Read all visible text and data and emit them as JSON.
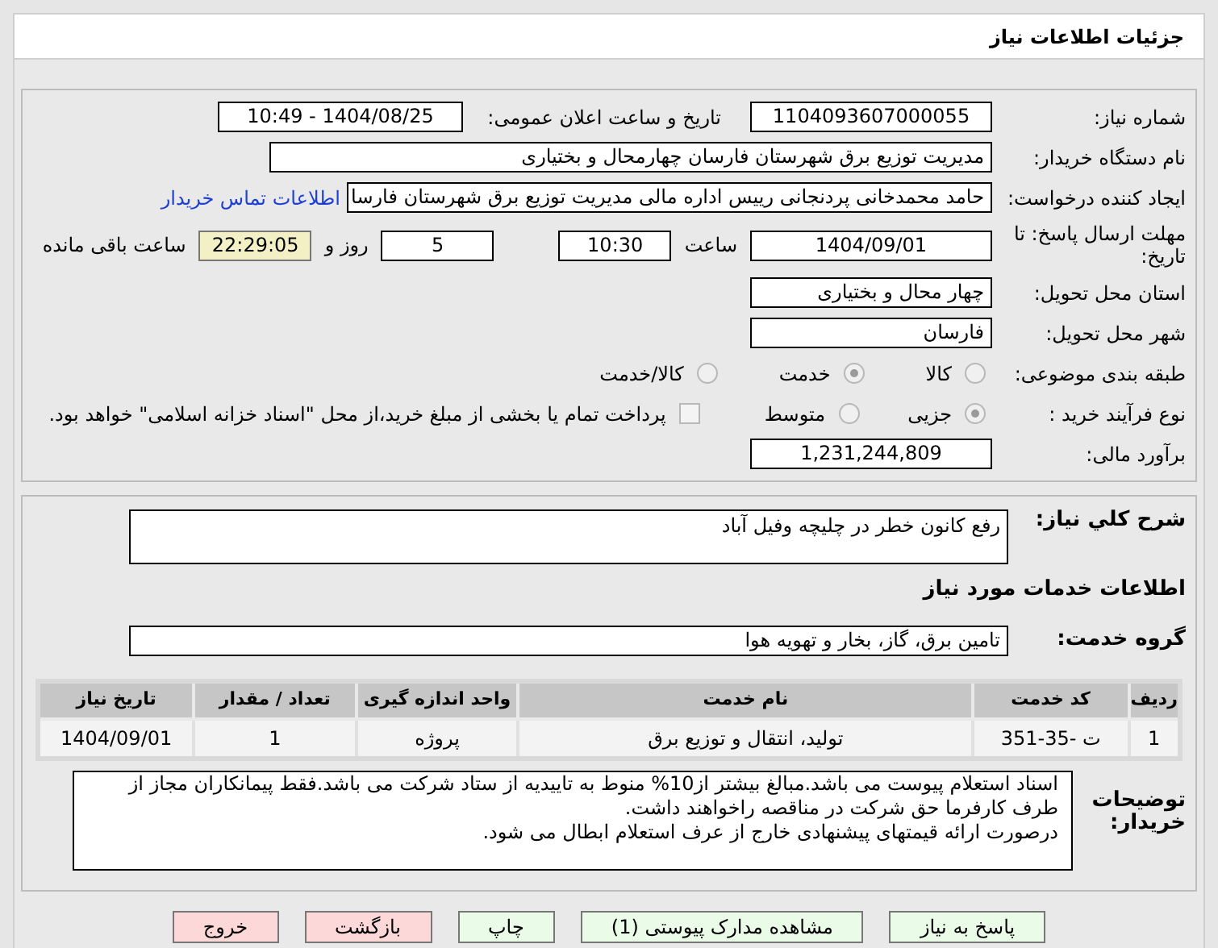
{
  "header": {
    "title": "جزئیات اطلاعات نیاز"
  },
  "details": {
    "need_number": {
      "label": "شماره نیاز:",
      "value": "1104093607000055"
    },
    "announce": {
      "label": "تاریخ و ساعت اعلان عمومی:",
      "value": "1404/08/25 - 10:49"
    },
    "buyer": {
      "label": "نام دستگاه خریدار:",
      "value": "مدیریت توزیع برق شهرستان فارسان چهارمحال و بختیاری"
    },
    "creator": {
      "label": "ایجاد کننده درخواست:",
      "value": "حامد محمدخانی پردنجانی رییس اداره مالی مدیریت توزیع برق شهرستان فارسا",
      "link": "اطلاعات تماس خریدار"
    },
    "deadline": {
      "label": "مهلت ارسال پاسخ: تا تاریخ:",
      "date": "1404/09/01",
      "time_label": "ساعت",
      "time": "10:30",
      "days": "5",
      "days_label": "روز و",
      "remaining": "22:29:05",
      "remaining_label": "ساعت باقی مانده"
    },
    "province": {
      "label": "استان محل تحویل:",
      "value": "چهار محال و بختیاری"
    },
    "city": {
      "label": "شهر محل تحویل:",
      "value": "فارسان"
    },
    "category": {
      "label": "طبقه بندی موضوعی:",
      "options": [
        {
          "label": "کالا",
          "selected": false
        },
        {
          "label": "خدمت",
          "selected": true
        },
        {
          "label": "کالا/خدمت",
          "selected": false
        }
      ]
    },
    "process": {
      "label": "نوع فرآیند خرید :",
      "options": [
        {
          "label": "جزیی",
          "selected": true
        },
        {
          "label": "متوسط",
          "selected": false
        }
      ],
      "treasury": {
        "label": "پرداخت تمام یا بخشی از مبلغ خرید،از محل \"اسناد خزانه اسلامی\" خواهد بود.",
        "checked": false
      }
    },
    "estimate": {
      "label": "برآورد مالی:",
      "value": "1,231,244,809"
    }
  },
  "needs": {
    "summary": {
      "label": "شرح کلي نیاز:",
      "value": "رفع کانون خطر در چلیچه وفیل آباد"
    },
    "services_heading": "اطلاعات خدمات مورد نیاز",
    "service_group": {
      "label": "گروه خدمت:",
      "value": "تامین برق، گاز، بخار و تهویه هوا"
    },
    "table": {
      "columns": [
        "ردیف",
        "کد خدمت",
        "نام خدمت",
        "واحد اندازه گیری",
        "تعداد / مقدار",
        "تاریخ نیاز"
      ],
      "rows": [
        [
          "1",
          "ت -35-351",
          "تولید، انتقال و توزیع برق",
          "پروژه",
          "1",
          "1404/09/01"
        ]
      ]
    },
    "buyer_notes": {
      "label": "توضیحات خریدار:",
      "paragraphs": [
        "اسناد استعلام پیوست می باشد.مبالغ بیشتر از10% منوط به تاییدیه از ستاد شرکت می باشد.فقط پیمانکاران مجاز از طرف کارفرما حق شرکت در مناقصه راخواهند داشت.",
        "درصورت ارائه قیمتهای پیشنهادی خارج از عرف استعلام ابطال می شود."
      ]
    }
  },
  "buttons": [
    {
      "label": "پاسخ به نیاز",
      "kind": "primary"
    },
    {
      "label": "مشاهده مدارک پیوستی (1)",
      "kind": "primary"
    },
    {
      "label": "چاپ",
      "kind": "primary"
    },
    {
      "label": "بازگشت",
      "kind": "danger"
    },
    {
      "label": "خروج",
      "kind": "danger"
    }
  ]
}
